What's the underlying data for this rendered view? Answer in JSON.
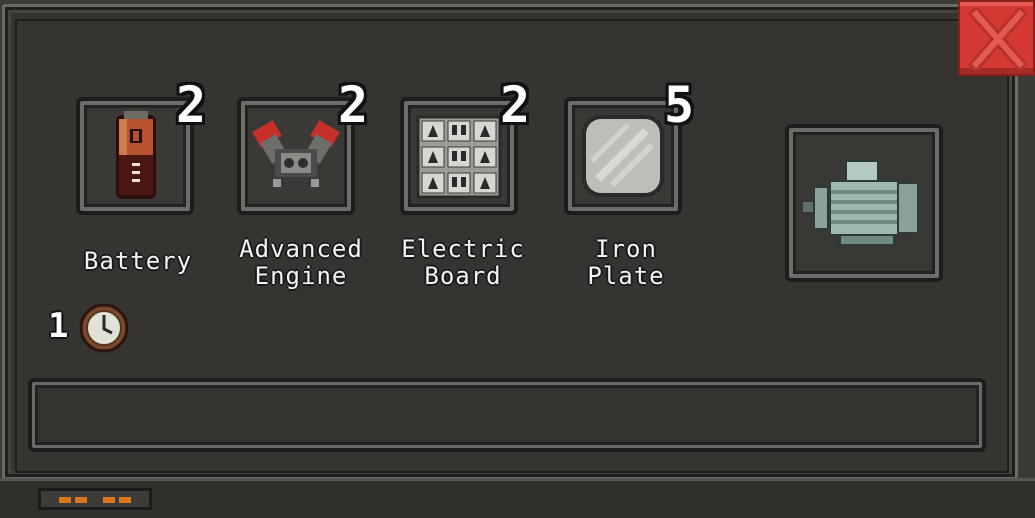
{
  "window": {
    "close_label": "close"
  },
  "recipe": {
    "ingredients": [
      {
        "name": "Battery",
        "quantity": "2",
        "icon": "battery-icon"
      },
      {
        "name": "Advanced\nEngine",
        "quantity": "2",
        "icon": "engine-icon"
      },
      {
        "name": "Electric\nBoard",
        "quantity": "2",
        "icon": "circuit-board-icon"
      },
      {
        "name": "Iron\nPlate",
        "quantity": "5",
        "icon": "iron-plate-icon"
      }
    ],
    "output": {
      "icon": "electric-motor-icon"
    },
    "time": "1",
    "progress": 0
  },
  "colors": {
    "panel": "#353431",
    "close": "#d43a33",
    "accent": "#d9781f"
  }
}
